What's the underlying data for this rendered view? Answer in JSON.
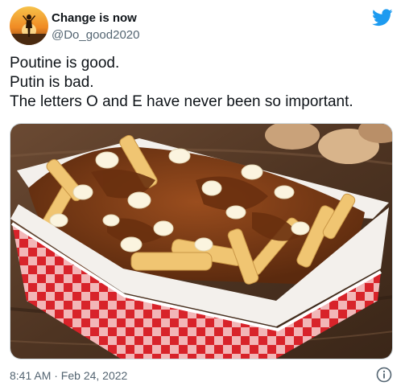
{
  "user": {
    "display_name": "Change is now",
    "handle": "@Do_good2020",
    "avatar_icon": "sunset-silhouette-avatar"
  },
  "tweet": {
    "lines": [
      "Poutine is good.",
      "Putin is bad.",
      "The letters O and E have never been so important."
    ],
    "timestamp": "8:41 AM · Feb 24, 2022"
  },
  "media": {
    "icon": "poutine-photo"
  },
  "icons": {
    "brand": "twitter-bird-icon",
    "info": "info-icon"
  },
  "colors": {
    "brand_blue": "#1d9bf0",
    "secondary_text": "#536471",
    "primary_text": "#0f1419"
  }
}
